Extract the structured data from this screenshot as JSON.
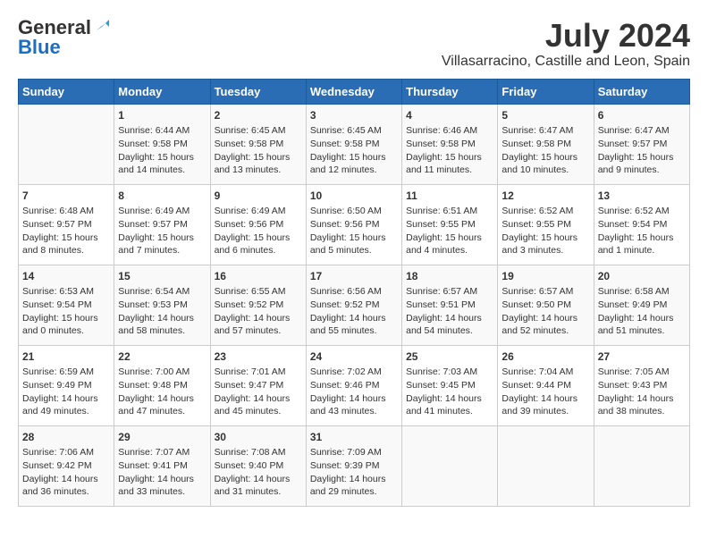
{
  "header": {
    "logo_general": "General",
    "logo_blue": "Blue",
    "month_title": "July 2024",
    "location": "Villasarracino, Castille and Leon, Spain"
  },
  "days_of_week": [
    "Sunday",
    "Monday",
    "Tuesday",
    "Wednesday",
    "Thursday",
    "Friday",
    "Saturday"
  ],
  "weeks": [
    [
      {
        "day": "",
        "content": ""
      },
      {
        "day": "1",
        "content": "Sunrise: 6:44 AM\nSunset: 9:58 PM\nDaylight: 15 hours\nand 14 minutes."
      },
      {
        "day": "2",
        "content": "Sunrise: 6:45 AM\nSunset: 9:58 PM\nDaylight: 15 hours\nand 13 minutes."
      },
      {
        "day": "3",
        "content": "Sunrise: 6:45 AM\nSunset: 9:58 PM\nDaylight: 15 hours\nand 12 minutes."
      },
      {
        "day": "4",
        "content": "Sunrise: 6:46 AM\nSunset: 9:58 PM\nDaylight: 15 hours\nand 11 minutes."
      },
      {
        "day": "5",
        "content": "Sunrise: 6:47 AM\nSunset: 9:58 PM\nDaylight: 15 hours\nand 10 minutes."
      },
      {
        "day": "6",
        "content": "Sunrise: 6:47 AM\nSunset: 9:57 PM\nDaylight: 15 hours\nand 9 minutes."
      }
    ],
    [
      {
        "day": "7",
        "content": "Sunrise: 6:48 AM\nSunset: 9:57 PM\nDaylight: 15 hours\nand 8 minutes."
      },
      {
        "day": "8",
        "content": "Sunrise: 6:49 AM\nSunset: 9:57 PM\nDaylight: 15 hours\nand 7 minutes."
      },
      {
        "day": "9",
        "content": "Sunrise: 6:49 AM\nSunset: 9:56 PM\nDaylight: 15 hours\nand 6 minutes."
      },
      {
        "day": "10",
        "content": "Sunrise: 6:50 AM\nSunset: 9:56 PM\nDaylight: 15 hours\nand 5 minutes."
      },
      {
        "day": "11",
        "content": "Sunrise: 6:51 AM\nSunset: 9:55 PM\nDaylight: 15 hours\nand 4 minutes."
      },
      {
        "day": "12",
        "content": "Sunrise: 6:52 AM\nSunset: 9:55 PM\nDaylight: 15 hours\nand 3 minutes."
      },
      {
        "day": "13",
        "content": "Sunrise: 6:52 AM\nSunset: 9:54 PM\nDaylight: 15 hours\nand 1 minute."
      }
    ],
    [
      {
        "day": "14",
        "content": "Sunrise: 6:53 AM\nSunset: 9:54 PM\nDaylight: 15 hours\nand 0 minutes."
      },
      {
        "day": "15",
        "content": "Sunrise: 6:54 AM\nSunset: 9:53 PM\nDaylight: 14 hours\nand 58 minutes."
      },
      {
        "day": "16",
        "content": "Sunrise: 6:55 AM\nSunset: 9:52 PM\nDaylight: 14 hours\nand 57 minutes."
      },
      {
        "day": "17",
        "content": "Sunrise: 6:56 AM\nSunset: 9:52 PM\nDaylight: 14 hours\nand 55 minutes."
      },
      {
        "day": "18",
        "content": "Sunrise: 6:57 AM\nSunset: 9:51 PM\nDaylight: 14 hours\nand 54 minutes."
      },
      {
        "day": "19",
        "content": "Sunrise: 6:57 AM\nSunset: 9:50 PM\nDaylight: 14 hours\nand 52 minutes."
      },
      {
        "day": "20",
        "content": "Sunrise: 6:58 AM\nSunset: 9:49 PM\nDaylight: 14 hours\nand 51 minutes."
      }
    ],
    [
      {
        "day": "21",
        "content": "Sunrise: 6:59 AM\nSunset: 9:49 PM\nDaylight: 14 hours\nand 49 minutes."
      },
      {
        "day": "22",
        "content": "Sunrise: 7:00 AM\nSunset: 9:48 PM\nDaylight: 14 hours\nand 47 minutes."
      },
      {
        "day": "23",
        "content": "Sunrise: 7:01 AM\nSunset: 9:47 PM\nDaylight: 14 hours\nand 45 minutes."
      },
      {
        "day": "24",
        "content": "Sunrise: 7:02 AM\nSunset: 9:46 PM\nDaylight: 14 hours\nand 43 minutes."
      },
      {
        "day": "25",
        "content": "Sunrise: 7:03 AM\nSunset: 9:45 PM\nDaylight: 14 hours\nand 41 minutes."
      },
      {
        "day": "26",
        "content": "Sunrise: 7:04 AM\nSunset: 9:44 PM\nDaylight: 14 hours\nand 39 minutes."
      },
      {
        "day": "27",
        "content": "Sunrise: 7:05 AM\nSunset: 9:43 PM\nDaylight: 14 hours\nand 38 minutes."
      }
    ],
    [
      {
        "day": "28",
        "content": "Sunrise: 7:06 AM\nSunset: 9:42 PM\nDaylight: 14 hours\nand 36 minutes."
      },
      {
        "day": "29",
        "content": "Sunrise: 7:07 AM\nSunset: 9:41 PM\nDaylight: 14 hours\nand 33 minutes."
      },
      {
        "day": "30",
        "content": "Sunrise: 7:08 AM\nSunset: 9:40 PM\nDaylight: 14 hours\nand 31 minutes."
      },
      {
        "day": "31",
        "content": "Sunrise: 7:09 AM\nSunset: 9:39 PM\nDaylight: 14 hours\nand 29 minutes."
      },
      {
        "day": "",
        "content": ""
      },
      {
        "day": "",
        "content": ""
      },
      {
        "day": "",
        "content": ""
      }
    ]
  ]
}
